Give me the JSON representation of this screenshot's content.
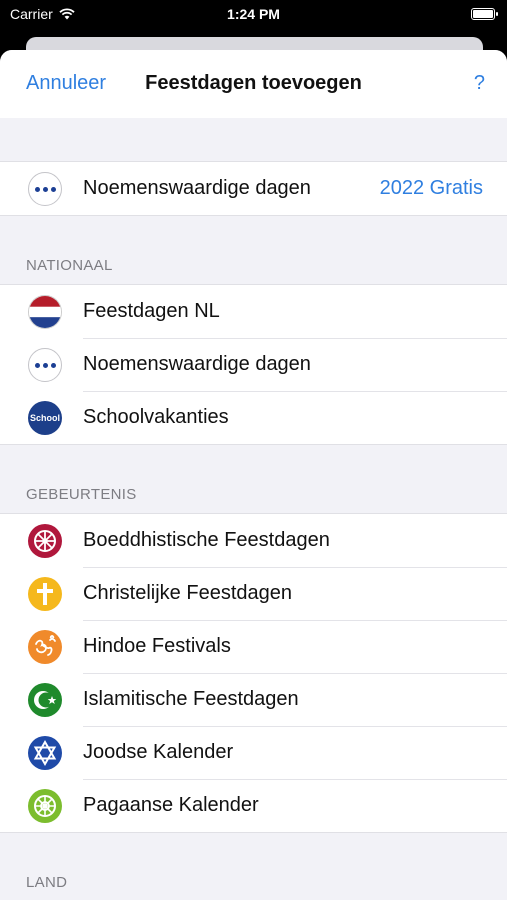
{
  "status": {
    "carrier": "Carrier",
    "time": "1:24 PM"
  },
  "nav": {
    "cancel": "Annuleer",
    "title": "Feestdagen toevoegen",
    "help": "?"
  },
  "promo": {
    "label": "Noemenswaardige dagen",
    "right": "2022 Gratis",
    "icon": "dots-icon"
  },
  "sections": {
    "national": {
      "header": "NATIONAAL",
      "items": [
        {
          "label": "Feestdagen NL",
          "icon": "netherlands-flag-icon"
        },
        {
          "label": "Noemenswaardige dagen",
          "icon": "dots-icon"
        },
        {
          "label": "Schoolvakanties",
          "icon": "school-icon",
          "icon_text": "School"
        }
      ]
    },
    "event": {
      "header": "GEBEURTENIS",
      "items": [
        {
          "label": "Boeddhistische Feestdagen",
          "icon": "dharma-wheel-icon",
          "color": "#b0173c"
        },
        {
          "label": "Christelijke Feestdagen",
          "icon": "cross-icon",
          "color": "#f5b81c"
        },
        {
          "label": "Hindoe Festivals",
          "icon": "om-icon",
          "color": "#f08a2b"
        },
        {
          "label": "Islamitische Feestdagen",
          "icon": "crescent-star-icon",
          "color": "#1f8a2c"
        },
        {
          "label": "Joodse Kalender",
          "icon": "star-of-david-icon",
          "color": "#1f4aa8"
        },
        {
          "label": "Pagaanse Kalender",
          "icon": "pagan-wheel-icon",
          "color": "#7cbd2e"
        }
      ]
    },
    "country": {
      "header": "LAND"
    }
  }
}
